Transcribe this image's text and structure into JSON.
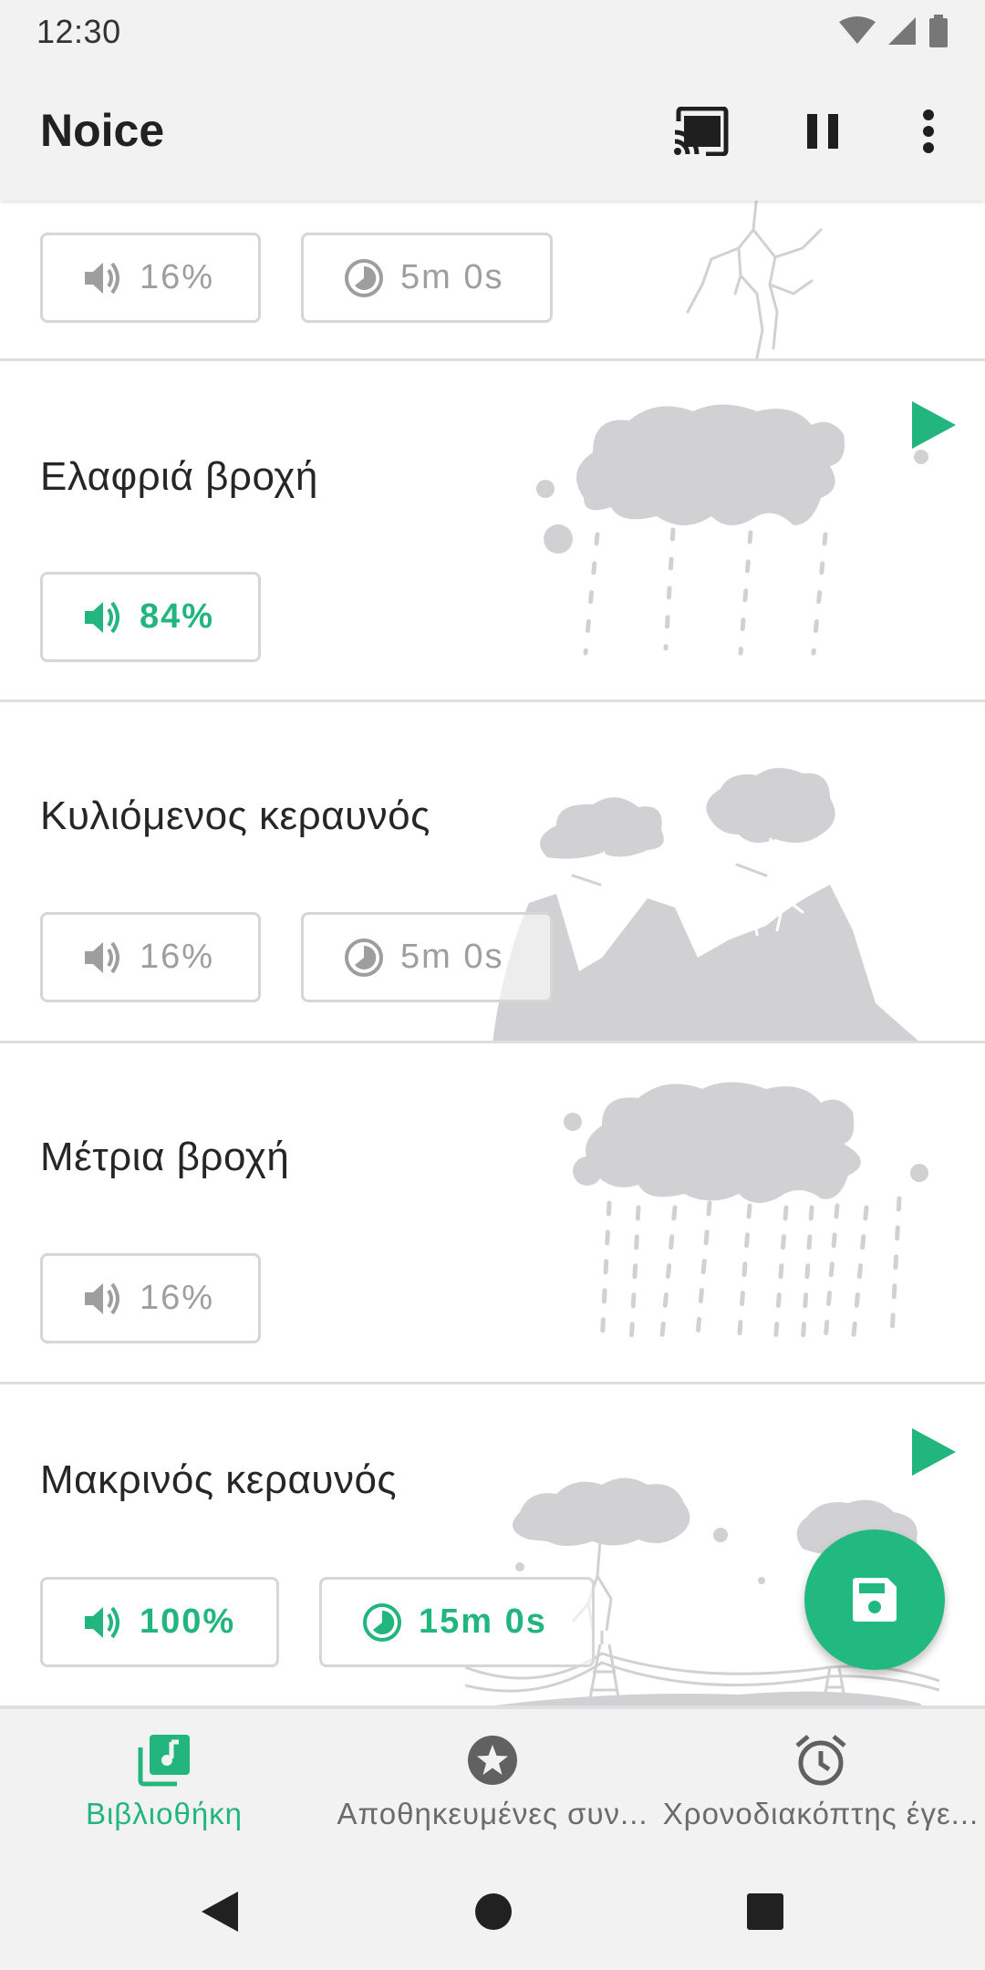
{
  "status_bar": {
    "time": "12:30"
  },
  "app_bar": {
    "title": "Noice"
  },
  "colors": {
    "accent": "#22b57e",
    "inactive_text": "#9e9e9e",
    "art_gray": "#d1d1d3"
  },
  "sounds": [
    {
      "title": "",
      "volume": "16%",
      "timer": "5m 0s",
      "active": false
    },
    {
      "title": "Ελαφριά βροχή",
      "volume": "84%",
      "active": true,
      "playing_indicator": "play-icon"
    },
    {
      "title": "Κυλιόμενος κεραυνός",
      "volume": "16%",
      "timer": "5m 0s",
      "active": false
    },
    {
      "title": "Μέτρια βροχή",
      "volume": "16%",
      "active": false
    },
    {
      "title": "Μακρινός κεραυνός",
      "volume": "100%",
      "timer": "15m 0s",
      "active": true,
      "playing_indicator": "play-icon"
    }
  ],
  "fab": {
    "icon": "save-icon"
  },
  "bottom_nav": [
    {
      "label": "Βιβλιοθήκη",
      "icon": "library-music-icon",
      "active": true
    },
    {
      "label": "Αποθηκευμένες συν...",
      "icon": "star-icon",
      "active": false
    },
    {
      "label": "Χρονοδιακόπτης έγε...",
      "icon": "alarm-clock-icon",
      "active": false
    }
  ]
}
